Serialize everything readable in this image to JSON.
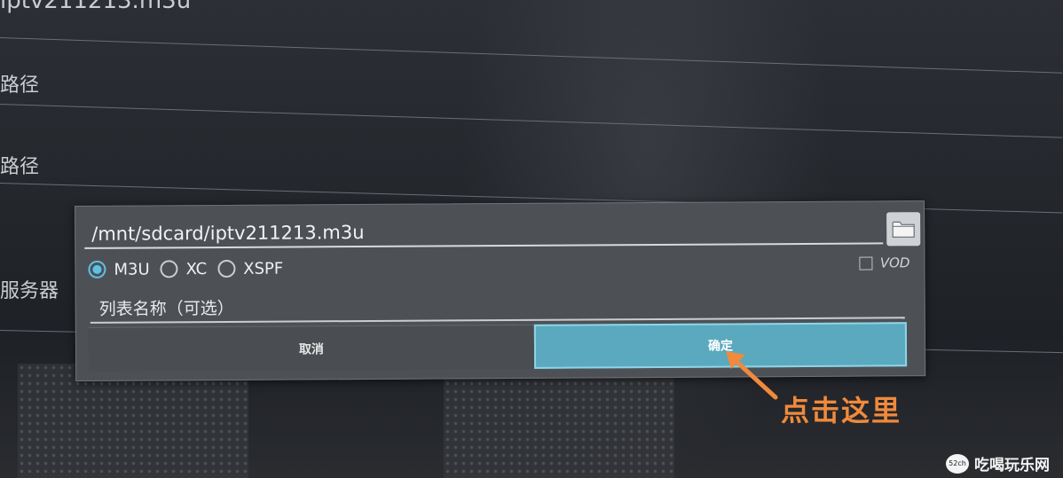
{
  "background": {
    "rows": [
      {
        "label": "iptv211213.m3u"
      },
      {
        "label": "路径"
      },
      {
        "label": "路径"
      },
      {
        "label": "服务器"
      }
    ]
  },
  "dialog": {
    "path_value": "/mnt/sdcard/iptv211213.m3u",
    "folder_icon": "folder-icon",
    "radio_options": [
      {
        "label": "M3U",
        "checked": true
      },
      {
        "label": "XC",
        "checked": false
      },
      {
        "label": "XSPF",
        "checked": false
      }
    ],
    "vod_label": "VOD",
    "vod_checked": false,
    "name_placeholder": "列表名称（可选）",
    "cancel_label": "取消",
    "ok_label": "确定"
  },
  "annotation": {
    "text": "点击这里",
    "color": "#f08a3c"
  },
  "watermark": {
    "logo_text": "52ch",
    "text": "吃喝玩乐网"
  },
  "colors": {
    "accent": "#5ec1e6",
    "ok_button": "#5aa9bf",
    "dialog_bg": "#4d5156"
  }
}
